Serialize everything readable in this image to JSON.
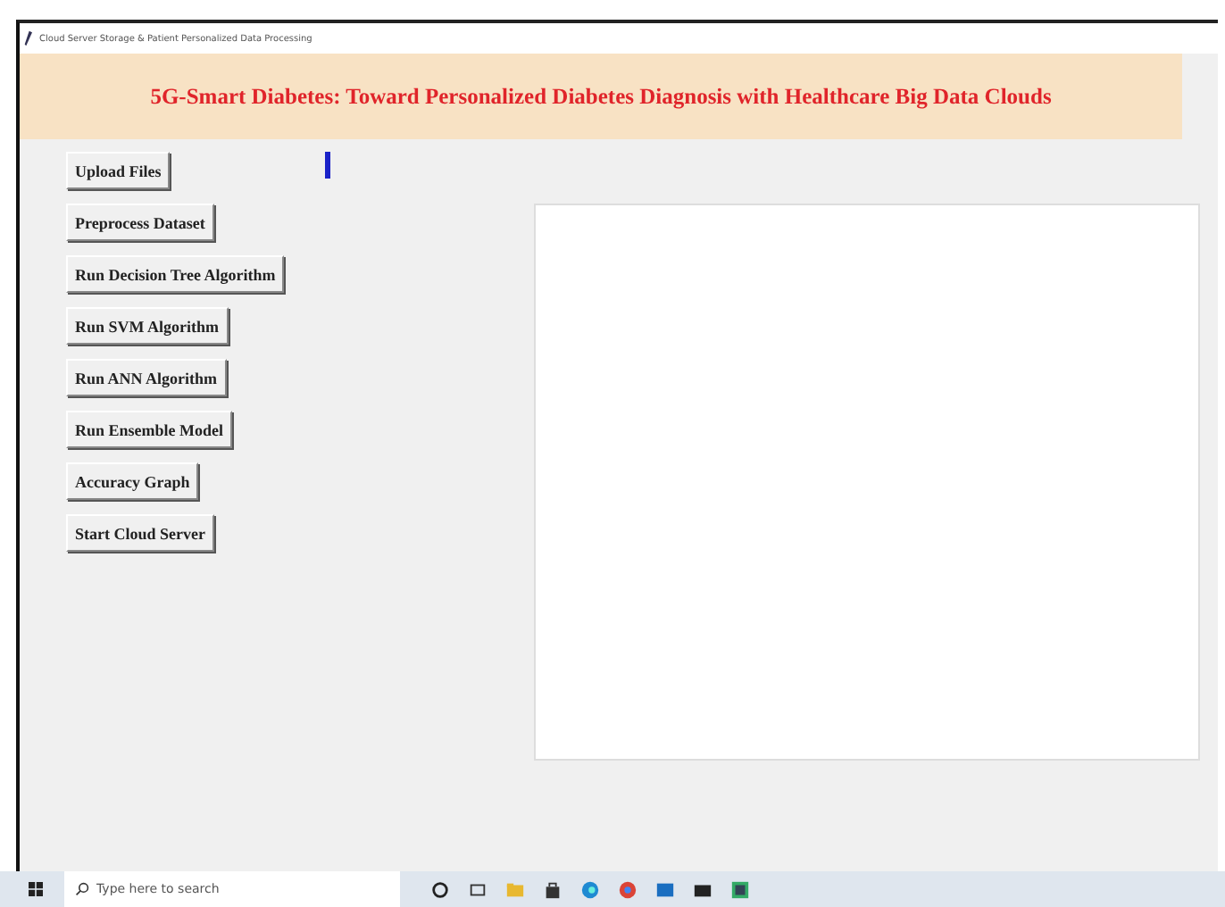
{
  "window": {
    "title": "Cloud Server Storage & Patient Personalized Data Processing"
  },
  "banner": {
    "title": "5G-Smart Diabetes: Toward Personalized Diabetes Diagnosis with Healthcare Big Data Clouds"
  },
  "buttons": [
    "Upload Files",
    "Preprocess Dataset",
    "Run Decision Tree Algorithm",
    "Run SVM Algorithm",
    "Run ANN Algorithm",
    "Run Ensemble Model",
    "Accuracy Graph",
    "Start Cloud Server"
  ],
  "taskbar": {
    "search": {
      "placeholder": "Type here to search"
    }
  }
}
